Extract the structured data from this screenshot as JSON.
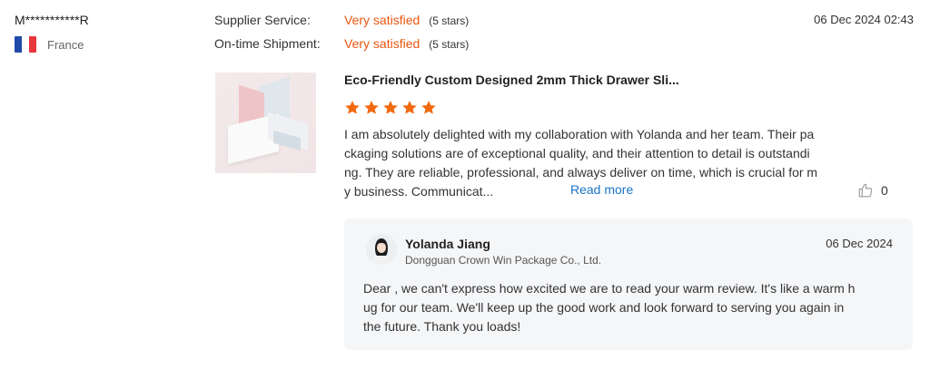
{
  "reviewer": {
    "name": "M***********R",
    "country": "France"
  },
  "ratings": [
    {
      "label": "Supplier Service:",
      "value": "Very satisfied",
      "stars_text": "(5 stars)"
    },
    {
      "label": "On-time Shipment:",
      "value": "Very satisfied",
      "stars_text": "(5 stars)"
    }
  ],
  "review_date": "06 Dec 2024 02:43",
  "product": {
    "title": "Eco-Friendly Custom Designed 2mm Thick Drawer Sli...",
    "rating": 5
  },
  "review": {
    "lines": [
      "I am absolutely delighted with my collaboration with Yolanda and her team. Their pa",
      "ckaging solutions are of exceptional quality, and their attention to detail is outstandi",
      "ng. They are reliable, professional, and always deliver on time, which is crucial for m",
      "y business. Communicat..."
    ],
    "read_more": "Read more",
    "likes": "0"
  },
  "reply": {
    "name": "Yolanda Jiang",
    "company": "Dongguan Crown Win Package Co., Ltd.",
    "date": "06 Dec 2024",
    "lines": [
      "Dear , we can't express how excited we are to read your warm review. It's like a warm h",
      "ug for our team. We'll keep up the good work and look forward to serving you again in",
      "the future. Thank you loads!"
    ]
  },
  "colors": {
    "accent": "#e8570f",
    "star": "#f26a10",
    "link": "#1a73c8",
    "flag": [
      "#1f4aa8",
      "#ffffff",
      "#e8363d"
    ]
  },
  "icons": {
    "flag": "france-flag-icon",
    "star": "star-icon",
    "like": "thumbs-up-icon"
  }
}
